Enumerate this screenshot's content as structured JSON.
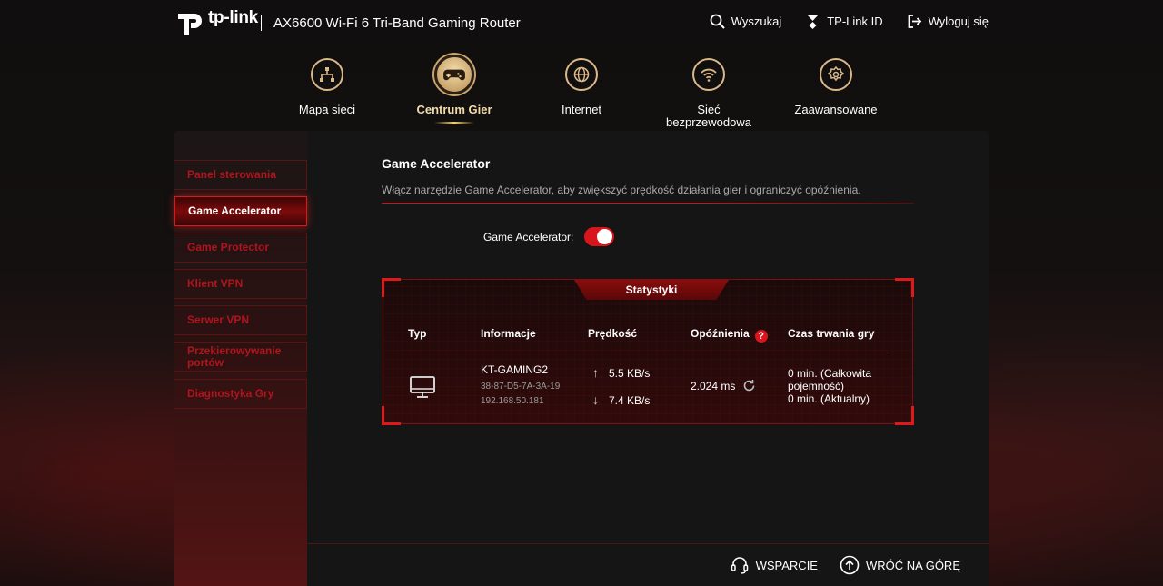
{
  "header": {
    "brand": "tp-link",
    "product": "AX6600 Wi-Fi 6 Tri-Band Gaming Router",
    "links": [
      {
        "label": "Wyszukaj",
        "icon": "search-icon"
      },
      {
        "label": "TP-Link ID",
        "icon": "tplink-id-icon"
      },
      {
        "label": "Wyloguj się",
        "icon": "logout-icon"
      }
    ]
  },
  "nav": {
    "active": "Centrum Gier",
    "items": [
      {
        "label": "Mapa sieci",
        "icon": "network-map-icon"
      },
      {
        "label": "Centrum Gier",
        "icon": "gamepad-icon"
      },
      {
        "label": "Internet",
        "icon": "globe-icon"
      },
      {
        "label": "Sieć bezprzewodowa",
        "icon": "wifi-icon"
      },
      {
        "label": "Zaawansowane",
        "icon": "gear-icon"
      }
    ]
  },
  "sidebar": {
    "active": "Game Accelerator",
    "items": [
      {
        "label": "Panel sterowania"
      },
      {
        "label": "Game Accelerator"
      },
      {
        "label": "Game Protector"
      },
      {
        "label": "Klient VPN"
      },
      {
        "label": "Serwer VPN"
      },
      {
        "label": "Przekierowywanie portów"
      },
      {
        "label": "Diagnostyka Gry"
      }
    ]
  },
  "content": {
    "title": "Game Accelerator",
    "description": "Włącz narzędzie Game Accelerator, aby zwiększyć prędkość działania gier i ograniczyć opóźnienia.",
    "toggle_label": "Game Accelerator:",
    "toggle_on": true
  },
  "stats": {
    "tab_label": "Statystyki",
    "columns": {
      "type": "Typ",
      "info": "Informacje",
      "speed": "Prędkość",
      "latency": "Opóźnienia",
      "latency_help": "?",
      "duration": "Czas trwania gry"
    },
    "row": {
      "device_icon": "desktop-icon",
      "name": "KT-GAMING2",
      "mac": "38-87-D5-7A-3A-19",
      "ip": "192.168.50.181",
      "upload": "5.5 KB/s",
      "download": "7.4 KB/s",
      "latency": "2.024 ms",
      "duration_total_line1": "0 min. (Całkowita",
      "duration_total_line2": "pojemność)",
      "duration_current": "0 min. (Aktualny)"
    }
  },
  "footer": {
    "support": "WSPARCIE",
    "back_to_top": "WRÓĆ NA GÓRĘ"
  },
  "colors": {
    "accent_red": "#d9141c",
    "gold": "#d9b98a",
    "sidebar_text": "#b0141c"
  }
}
